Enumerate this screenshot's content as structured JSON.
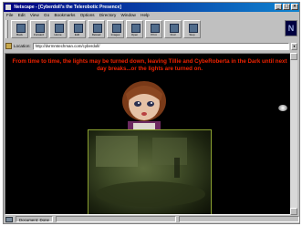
{
  "window": {
    "title": "Netscape - [Cyberdoll's the Telerobotic Presence]"
  },
  "menubar": {
    "items": [
      "File",
      "Edit",
      "View",
      "Go",
      "Bookmarks",
      "Options",
      "Directory",
      "Window",
      "Help"
    ]
  },
  "toolbar": {
    "buttons": [
      {
        "label": "Back",
        "icon": "back-arrow-icon"
      },
      {
        "label": "Forward",
        "icon": "forward-arrow-icon"
      },
      {
        "label": "Home",
        "icon": "home-icon"
      },
      {
        "label": "Edit",
        "icon": "edit-icon"
      },
      {
        "label": "Reload",
        "icon": "reload-icon"
      },
      {
        "label": "Images",
        "icon": "images-icon"
      },
      {
        "label": "Open",
        "icon": "open-icon"
      },
      {
        "label": "Print",
        "icon": "print-icon"
      },
      {
        "label": "Find",
        "icon": "find-icon"
      },
      {
        "label": "Stop",
        "icon": "stop-icon"
      }
    ]
  },
  "location": {
    "label": "Location:",
    "url": "http://dvrmmtechman.com/cyberdoll/"
  },
  "content": {
    "banner": "From time to time, the lights may be turned down, leaving Tillie and CybeRoberta in the Dark until next day breaks...or the lights are turned on.",
    "accent_color": "#ee2200"
  },
  "status": {
    "text": "Document: Done"
  }
}
